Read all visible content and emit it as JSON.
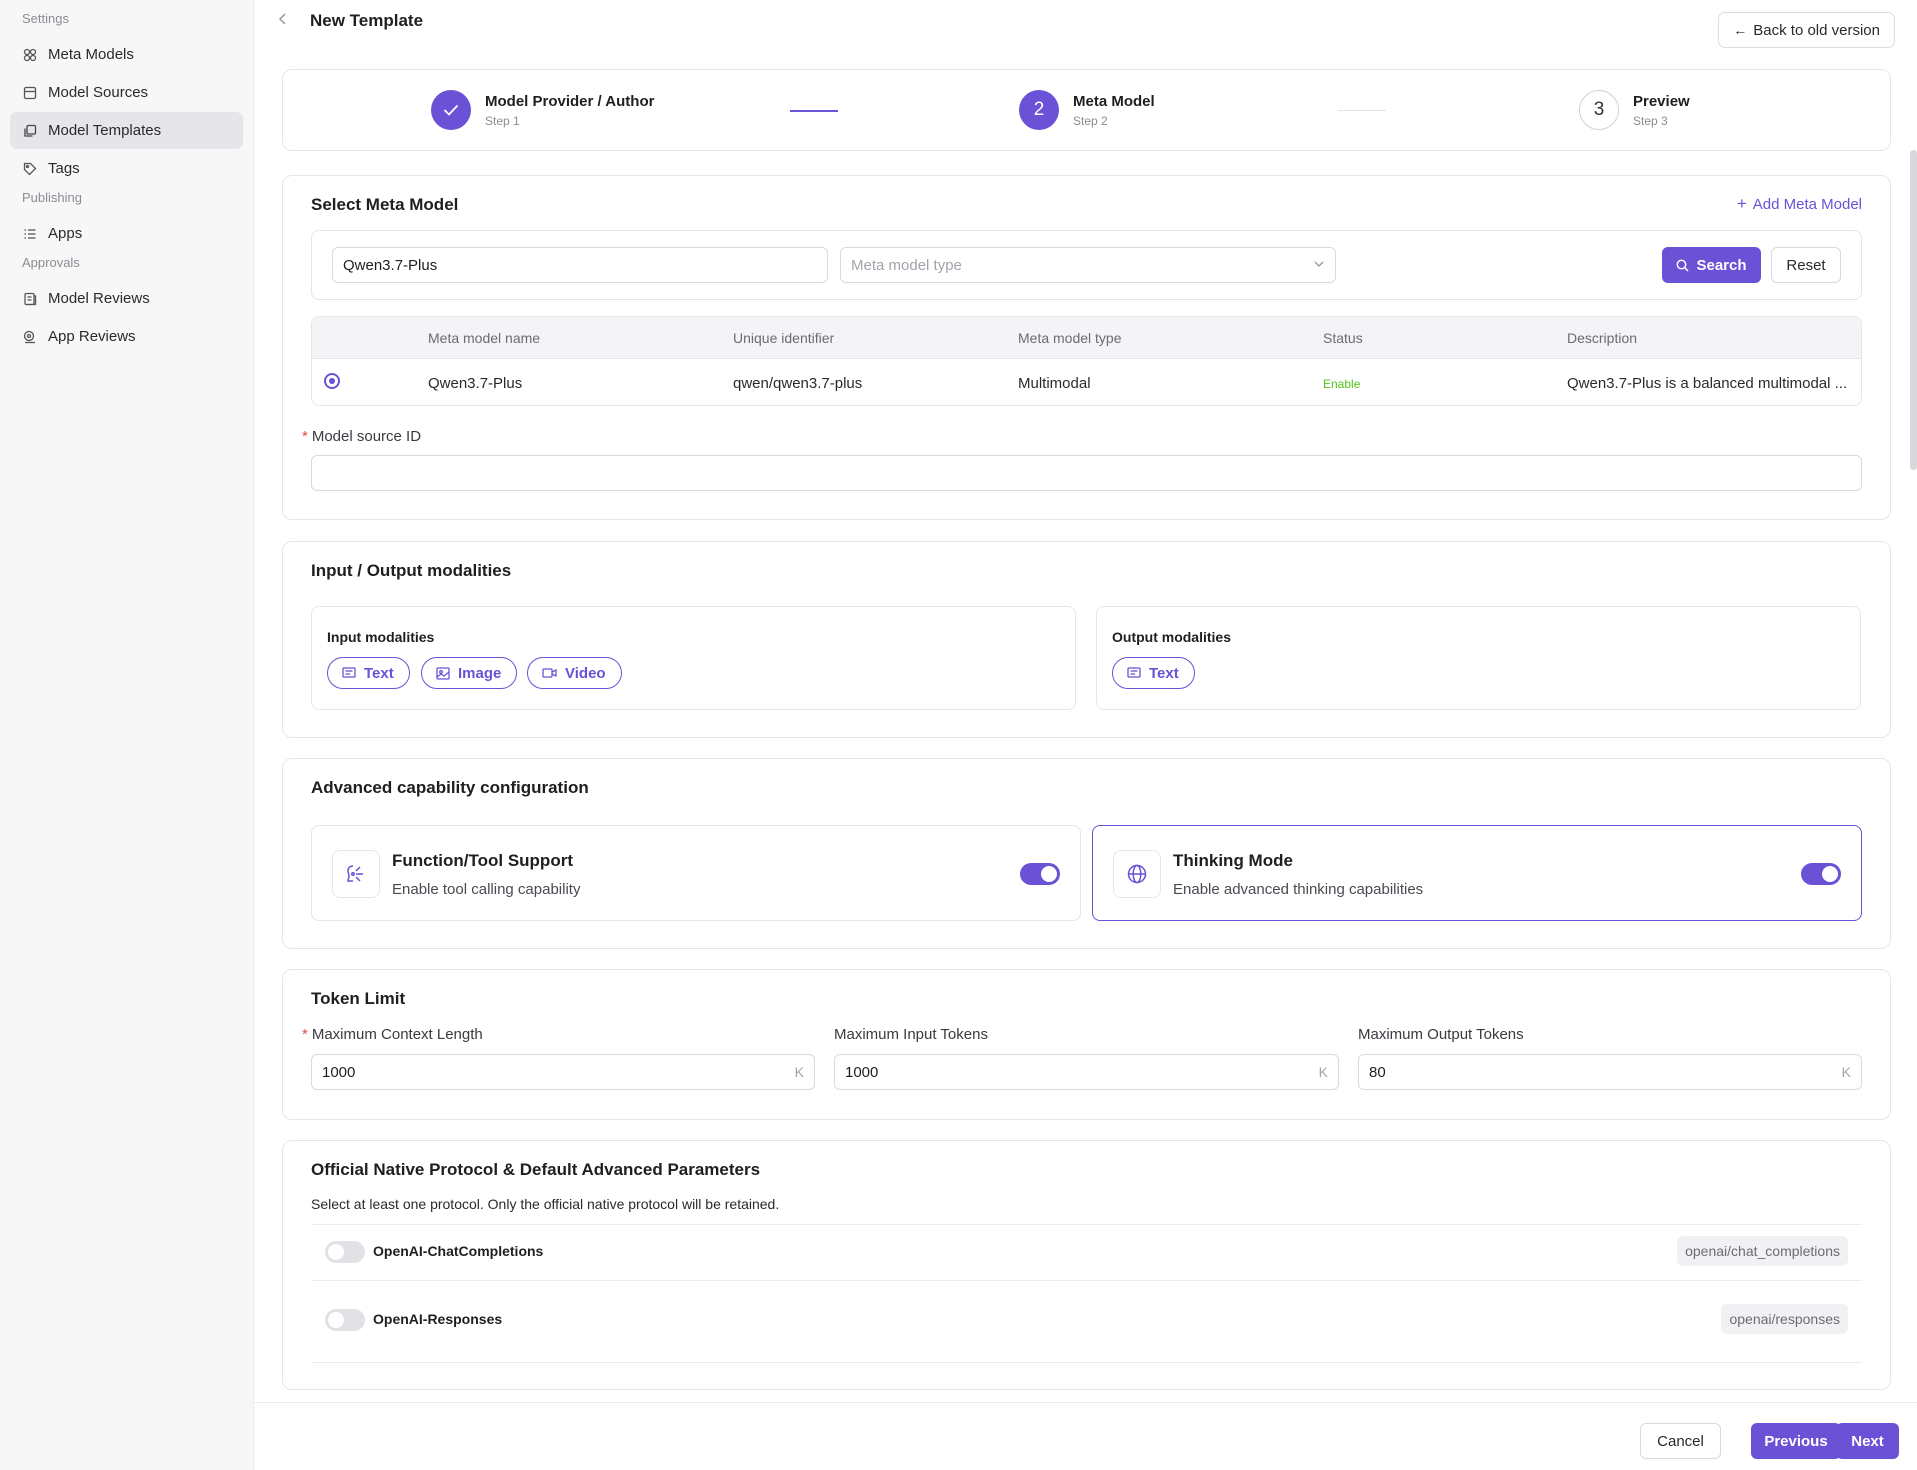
{
  "sidebar": {
    "sections": [
      {
        "title": "Settings",
        "items": [
          {
            "label": "Meta Models",
            "icon": "grid-cube-icon",
            "active": false
          },
          {
            "label": "Model Sources",
            "icon": "database-icon",
            "active": false
          },
          {
            "label": "Model Templates",
            "icon": "template-copy-icon",
            "active": true
          },
          {
            "label": "Tags",
            "icon": "tag-icon",
            "active": false
          }
        ]
      },
      {
        "title": "Publishing",
        "items": [
          {
            "label": "Apps",
            "icon": "list-icon",
            "active": false
          }
        ]
      },
      {
        "title": "Approvals",
        "items": [
          {
            "label": "Model Reviews",
            "icon": "review-doc-icon",
            "active": false
          },
          {
            "label": "App Reviews",
            "icon": "app-review-icon",
            "active": false
          }
        ]
      }
    ]
  },
  "header": {
    "title": "New Template",
    "back_old_label": "Back to old version"
  },
  "steps": [
    {
      "title": "Model Provider / Author",
      "sub": "Step 1",
      "state": "done",
      "number": ""
    },
    {
      "title": "Meta Model",
      "sub": "Step 2",
      "state": "current",
      "number": "2"
    },
    {
      "title": "Preview",
      "sub": "Step 3",
      "state": "todo",
      "number": "3"
    }
  ],
  "select_meta": {
    "title": "Select Meta Model",
    "add_label": "Add Meta Model",
    "search_value": "Qwen3.7-Plus",
    "type_placeholder": "Meta model type",
    "search_label": "Search",
    "reset_label": "Reset",
    "columns": [
      "Meta model name",
      "Unique identifier",
      "Meta model type",
      "Status",
      "Description"
    ],
    "row": {
      "name": "Qwen3.7-Plus",
      "identifier": "qwen/qwen3.7-plus",
      "type": "Multimodal",
      "status": "Enable",
      "description": "Qwen3.7-Plus is a balanced multimodal ..."
    },
    "source_id_label": "Model source ID",
    "source_id_value": ""
  },
  "modalities": {
    "title": "Input / Output modalities",
    "input_title": "Input modalities",
    "output_title": "Output modalities",
    "inputs": [
      "Text",
      "Image",
      "Video"
    ],
    "outputs": [
      "Text"
    ]
  },
  "capabilities": {
    "title": "Advanced capability configuration",
    "items": [
      {
        "title": "Function/Tool Support",
        "sub": "Enable tool calling capability",
        "enabled": true
      },
      {
        "title": "Thinking Mode",
        "sub": "Enable advanced thinking capabilities",
        "enabled": true
      }
    ]
  },
  "token_limit": {
    "title": "Token Limit",
    "fields": [
      {
        "label": "Maximum Context Length",
        "value": "1000",
        "suffix": "K",
        "required": true
      },
      {
        "label": "Maximum Input Tokens",
        "value": "1000",
        "suffix": "K",
        "required": false
      },
      {
        "label": "Maximum Output Tokens",
        "value": "80",
        "suffix": "K",
        "required": false
      }
    ]
  },
  "protocol": {
    "title": "Official Native Protocol & Default Advanced Parameters",
    "desc": "Select at least one protocol. Only the official native protocol will be retained.",
    "rows": [
      {
        "name": "OpenAI-ChatCompletions",
        "tag": "openai/chat_completions",
        "enabled": false
      },
      {
        "name": "OpenAI-Responses",
        "tag": "openai/responses",
        "enabled": false
      }
    ]
  },
  "footer": {
    "cancel": "Cancel",
    "previous": "Previous",
    "next": "Next"
  },
  "colors": {
    "accent": "#6a51d6",
    "status_enable": "#52c41a"
  }
}
